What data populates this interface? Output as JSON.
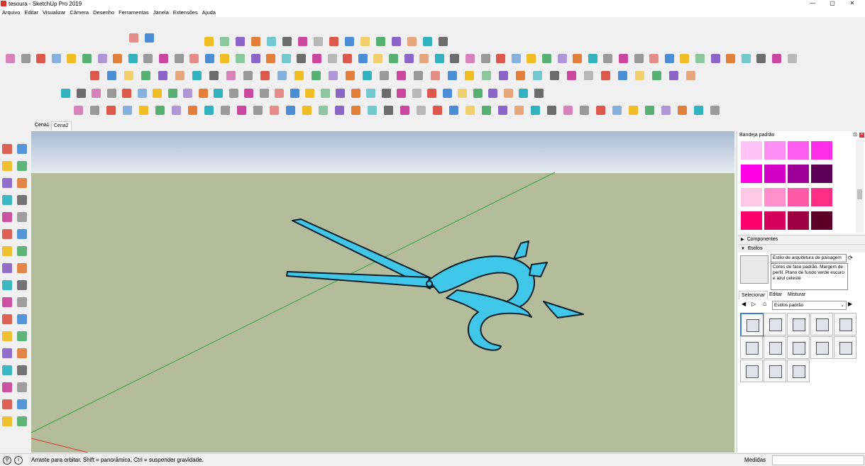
{
  "window": {
    "title": "tesoura - SketchUp Pro 2019",
    "minimize": "—",
    "maximize": "▢",
    "close": "✕"
  },
  "menu": [
    "Arquivo",
    "Editar",
    "Visualizar",
    "Câmera",
    "Desenho",
    "Ferramentas",
    "Janela",
    "Extensões",
    "Ajuda"
  ],
  "scene_tabs": [
    "Cena1",
    "Cena2"
  ],
  "active_scene": "Cena2",
  "tray": {
    "title": "Bandeja padrão",
    "sections": {
      "components": "Componentes",
      "styles": "Estilos"
    },
    "style": {
      "name": "Estilo de arquitetura de paisagem",
      "description": "Cores de face padrão. Margem de perfil. Plano de fundo verde escuro e azul celeste"
    },
    "subtabs": [
      "Selecionar",
      "Editar",
      "Misturar"
    ],
    "library_select": "Estilos padrão",
    "swatch_colors": [
      "#ffc3f5",
      "#ff8ef5",
      "#ff5cf0",
      "#ff2ce8",
      "#ff00e6",
      "#d400c8",
      "#9c0096",
      "#5c0055",
      "#ffc8e4",
      "#ff8ecc",
      "#ff5aa8",
      "#ff2d84",
      "#ff006a",
      "#d4005c",
      "#9c0040",
      "#5c0028"
    ]
  },
  "status": {
    "hint": "Arraste para orbitar. Shift = panorâmica, Ctrl = suspender gravidade.",
    "measure_label": "Medidas",
    "measure_value": ""
  },
  "colors": {
    "sky": "#b7c6d8",
    "ground": "#b5bc9b",
    "model": "#3fc6e8",
    "accent": "#3a7fd0"
  }
}
